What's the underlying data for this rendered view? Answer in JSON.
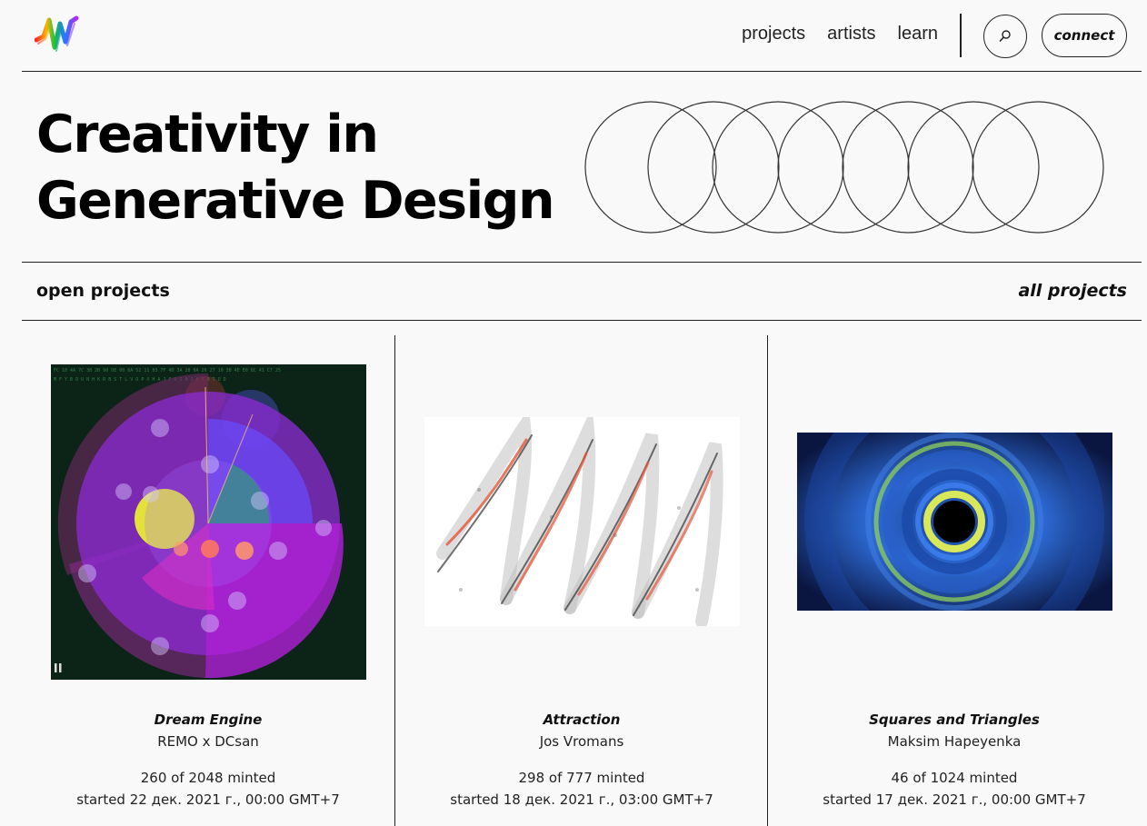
{
  "nav": {
    "items": [
      {
        "label": "projects"
      },
      {
        "label": "artists"
      },
      {
        "label": "learn"
      }
    ],
    "connect_label": "connect"
  },
  "hero": {
    "title_line1": "Creativity in",
    "title_line2": "Generative Design"
  },
  "section": {
    "label": "open projects",
    "all_link": "all projects"
  },
  "projects": [
    {
      "title": "Dream Engine",
      "artist": "REMO x DCsan",
      "minted": "260 of 2048 minted",
      "started": "started 22 дек. 2021 г., 00:00 GMT+7"
    },
    {
      "title": "Attraction",
      "artist": "Jos Vromans",
      "minted": "298 of 777 minted",
      "started": "started 18 дек. 2021 г., 03:00 GMT+7"
    },
    {
      "title": "Squares and Triangles",
      "artist": "Maksim Hapeyenka",
      "minted": "46 of 1024 minted",
      "started": "started 17 дек. 2021 г., 00:00 GMT+7"
    }
  ],
  "icons": {
    "logo": "rainbow-wave-logo",
    "search": "search-icon",
    "pause": "pause-icon"
  }
}
